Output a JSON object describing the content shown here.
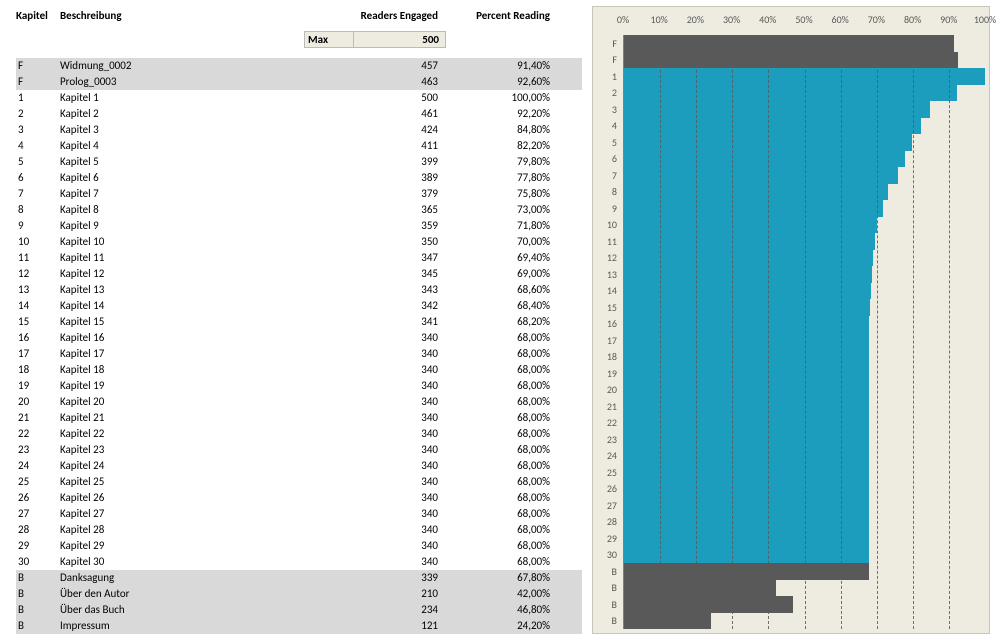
{
  "colors": {
    "chapter_bar": "#1D9DBD",
    "matter_bar": "#595959",
    "plot_bg": "#EEECE1",
    "grey_row": "#D9D9D9"
  },
  "headers": {
    "kapitel": "Kapitel",
    "beschreibung": "Beschreibung",
    "readers": "Readers Engaged",
    "percent": "Percent Reading"
  },
  "max": {
    "label": "Max",
    "value": "500"
  },
  "rows": [
    {
      "kapitel": "F",
      "type": "front",
      "beschreibung": "Widmung_0002",
      "readers": "457",
      "percent": "91,40%",
      "pct": 91.4
    },
    {
      "kapitel": "F",
      "type": "front",
      "beschreibung": "Prolog_0003",
      "readers": "463",
      "percent": "92,60%",
      "pct": 92.6
    },
    {
      "kapitel": "1",
      "type": "chapter",
      "beschreibung": "Kapitel 1",
      "readers": "500",
      "percent": "100,00%",
      "pct": 100.0
    },
    {
      "kapitel": "2",
      "type": "chapter",
      "beschreibung": "Kapitel 2",
      "readers": "461",
      "percent": "92,20%",
      "pct": 92.2
    },
    {
      "kapitel": "3",
      "type": "chapter",
      "beschreibung": "Kapitel 3",
      "readers": "424",
      "percent": "84,80%",
      "pct": 84.8
    },
    {
      "kapitel": "4",
      "type": "chapter",
      "beschreibung": "Kapitel 4",
      "readers": "411",
      "percent": "82,20%",
      "pct": 82.2
    },
    {
      "kapitel": "5",
      "type": "chapter",
      "beschreibung": "Kapitel 5",
      "readers": "399",
      "percent": "79,80%",
      "pct": 79.8
    },
    {
      "kapitel": "6",
      "type": "chapter",
      "beschreibung": "Kapitel 6",
      "readers": "389",
      "percent": "77,80%",
      "pct": 77.8
    },
    {
      "kapitel": "7",
      "type": "chapter",
      "beschreibung": "Kapitel 7",
      "readers": "379",
      "percent": "75,80%",
      "pct": 75.8
    },
    {
      "kapitel": "8",
      "type": "chapter",
      "beschreibung": "Kapitel 8",
      "readers": "365",
      "percent": "73,00%",
      "pct": 73.0
    },
    {
      "kapitel": "9",
      "type": "chapter",
      "beschreibung": "Kapitel 9",
      "readers": "359",
      "percent": "71,80%",
      "pct": 71.8
    },
    {
      "kapitel": "10",
      "type": "chapter",
      "beschreibung": "Kapitel 10",
      "readers": "350",
      "percent": "70,00%",
      "pct": 70.0
    },
    {
      "kapitel": "11",
      "type": "chapter",
      "beschreibung": "Kapitel 11",
      "readers": "347",
      "percent": "69,40%",
      "pct": 69.4
    },
    {
      "kapitel": "12",
      "type": "chapter",
      "beschreibung": "Kapitel 12",
      "readers": "345",
      "percent": "69,00%",
      "pct": 69.0
    },
    {
      "kapitel": "13",
      "type": "chapter",
      "beschreibung": "Kapitel 13",
      "readers": "343",
      "percent": "68,60%",
      "pct": 68.6
    },
    {
      "kapitel": "14",
      "type": "chapter",
      "beschreibung": "Kapitel 14",
      "readers": "342",
      "percent": "68,40%",
      "pct": 68.4
    },
    {
      "kapitel": "15",
      "type": "chapter",
      "beschreibung": "Kapitel 15",
      "readers": "341",
      "percent": "68,20%",
      "pct": 68.2
    },
    {
      "kapitel": "16",
      "type": "chapter",
      "beschreibung": "Kapitel 16",
      "readers": "340",
      "percent": "68,00%",
      "pct": 68.0
    },
    {
      "kapitel": "17",
      "type": "chapter",
      "beschreibung": "Kapitel 17",
      "readers": "340",
      "percent": "68,00%",
      "pct": 68.0
    },
    {
      "kapitel": "18",
      "type": "chapter",
      "beschreibung": "Kapitel 18",
      "readers": "340",
      "percent": "68,00%",
      "pct": 68.0
    },
    {
      "kapitel": "19",
      "type": "chapter",
      "beschreibung": "Kapitel 19",
      "readers": "340",
      "percent": "68,00%",
      "pct": 68.0
    },
    {
      "kapitel": "20",
      "type": "chapter",
      "beschreibung": "Kapitel 20",
      "readers": "340",
      "percent": "68,00%",
      "pct": 68.0
    },
    {
      "kapitel": "21",
      "type": "chapter",
      "beschreibung": "Kapitel 21",
      "readers": "340",
      "percent": "68,00%",
      "pct": 68.0
    },
    {
      "kapitel": "22",
      "type": "chapter",
      "beschreibung": "Kapitel 22",
      "readers": "340",
      "percent": "68,00%",
      "pct": 68.0
    },
    {
      "kapitel": "23",
      "type": "chapter",
      "beschreibung": "Kapitel 23",
      "readers": "340",
      "percent": "68,00%",
      "pct": 68.0
    },
    {
      "kapitel": "24",
      "type": "chapter",
      "beschreibung": "Kapitel 24",
      "readers": "340",
      "percent": "68,00%",
      "pct": 68.0
    },
    {
      "kapitel": "25",
      "type": "chapter",
      "beschreibung": "Kapitel 25",
      "readers": "340",
      "percent": "68,00%",
      "pct": 68.0
    },
    {
      "kapitel": "26",
      "type": "chapter",
      "beschreibung": "Kapitel 26",
      "readers": "340",
      "percent": "68,00%",
      "pct": 68.0
    },
    {
      "kapitel": "27",
      "type": "chapter",
      "beschreibung": "Kapitel 27",
      "readers": "340",
      "percent": "68,00%",
      "pct": 68.0
    },
    {
      "kapitel": "28",
      "type": "chapter",
      "beschreibung": "Kapitel 28",
      "readers": "340",
      "percent": "68,00%",
      "pct": 68.0
    },
    {
      "kapitel": "29",
      "type": "chapter",
      "beschreibung": "Kapitel 29",
      "readers": "340",
      "percent": "68,00%",
      "pct": 68.0
    },
    {
      "kapitel": "30",
      "type": "chapter",
      "beschreibung": "Kapitel 30",
      "readers": "340",
      "percent": "68,00%",
      "pct": 68.0
    },
    {
      "kapitel": "B",
      "type": "back",
      "beschreibung": "Danksagung",
      "readers": "339",
      "percent": "67,80%",
      "pct": 67.8
    },
    {
      "kapitel": "B",
      "type": "back",
      "beschreibung": "Über den Autor",
      "readers": "210",
      "percent": "42,00%",
      "pct": 42.0
    },
    {
      "kapitel": "B",
      "type": "back",
      "beschreibung": "Über das Buch",
      "readers": "234",
      "percent": "46,80%",
      "pct": 46.8
    },
    {
      "kapitel": "B",
      "type": "back",
      "beschreibung": "Impressum",
      "readers": "121",
      "percent": "24,20%",
      "pct": 24.2
    }
  ],
  "chart_data": {
    "type": "bar",
    "orientation": "horizontal",
    "xlabel": "",
    "ylabel": "",
    "xlim": [
      0,
      100
    ],
    "xticks": [
      "0%",
      "10%",
      "20%",
      "30%",
      "40%",
      "50%",
      "60%",
      "70%",
      "80%",
      "90%",
      "100%"
    ],
    "categories": [
      "F",
      "F",
      "1",
      "2",
      "3",
      "4",
      "5",
      "6",
      "7",
      "8",
      "9",
      "10",
      "11",
      "12",
      "13",
      "14",
      "15",
      "16",
      "17",
      "18",
      "19",
      "20",
      "21",
      "22",
      "23",
      "24",
      "25",
      "26",
      "27",
      "28",
      "29",
      "30",
      "B",
      "B",
      "B",
      "B"
    ],
    "series_type": [
      "matter",
      "matter",
      "chapter",
      "chapter",
      "chapter",
      "chapter",
      "chapter",
      "chapter",
      "chapter",
      "chapter",
      "chapter",
      "chapter",
      "chapter",
      "chapter",
      "chapter",
      "chapter",
      "chapter",
      "chapter",
      "chapter",
      "chapter",
      "chapter",
      "chapter",
      "chapter",
      "chapter",
      "chapter",
      "chapter",
      "chapter",
      "chapter",
      "chapter",
      "chapter",
      "chapter",
      "chapter",
      "matter",
      "matter",
      "matter",
      "matter"
    ],
    "values": [
      91.4,
      92.6,
      100.0,
      92.2,
      84.8,
      82.2,
      79.8,
      77.8,
      75.8,
      73.0,
      71.8,
      70.0,
      69.4,
      69.0,
      68.6,
      68.4,
      68.2,
      68.0,
      68.0,
      68.0,
      68.0,
      68.0,
      68.0,
      68.0,
      68.0,
      68.0,
      68.0,
      68.0,
      68.0,
      68.0,
      68.0,
      68.0,
      67.8,
      42.0,
      46.8,
      24.2
    ]
  }
}
